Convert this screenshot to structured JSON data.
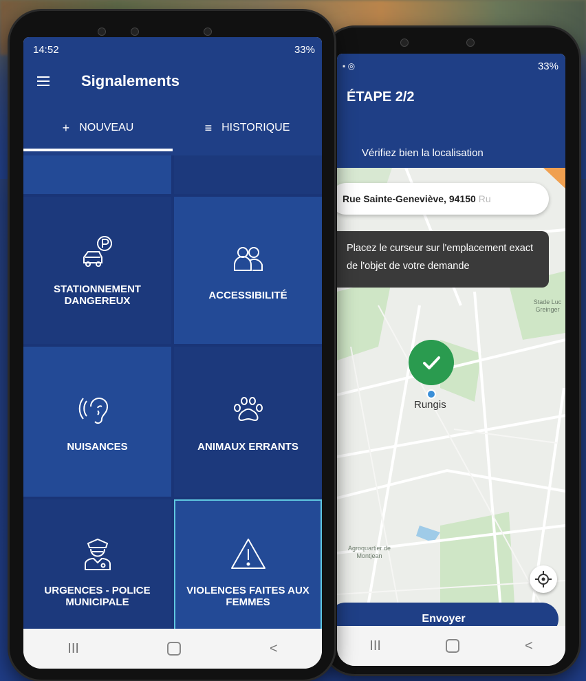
{
  "left_phone": {
    "status": {
      "time": "14:52",
      "right": "33%"
    },
    "app_title": "Signalements",
    "tabs": [
      {
        "icon": "+",
        "label": "NOUVEAU",
        "active": true
      },
      {
        "icon": "≡",
        "label": "HISTORIQUE",
        "active": false
      }
    ],
    "tiles": [
      {
        "label": "STATIONNEMENT DANGEREUX",
        "icon": "car-parking-icon"
      },
      {
        "label": "ACCESSIBILITÉ",
        "icon": "people-icon"
      },
      {
        "label": "NUISANCES",
        "icon": "ear-icon"
      },
      {
        "label": "ANIMAUX ERRANTS",
        "icon": "paw-icon"
      },
      {
        "label": "URGENCES - POLICE MUNICIPALE",
        "icon": "police-officer-icon"
      },
      {
        "label": "VIOLENCES FAITES AUX FEMMES",
        "icon": "warning-icon"
      }
    ],
    "nav": {
      "recents": "III",
      "back": "<"
    }
  },
  "right_phone": {
    "status": {
      "right": "33%"
    },
    "step_title": "ÉTAPE 2/2",
    "hint": "Vérifiez bien la localisation",
    "address": "Rue Sainte-Geneviève, 94150",
    "address_faded": "Ru",
    "tooltip": "Placez le curseur sur l'emplacement exact de l'objet de votre demande",
    "town_label": "Rungis",
    "poi_stade": "Stade Luc Greinger",
    "poi_agro": "Agroquartier de Montjean",
    "send_label": "Envoyer",
    "nav": {
      "recents": "III",
      "back": "<"
    }
  },
  "colors": {
    "primary": "#1f3f86",
    "tile_dark": "#1c397c",
    "tile_light": "#234a96",
    "pin_green": "#2a9b4f"
  }
}
